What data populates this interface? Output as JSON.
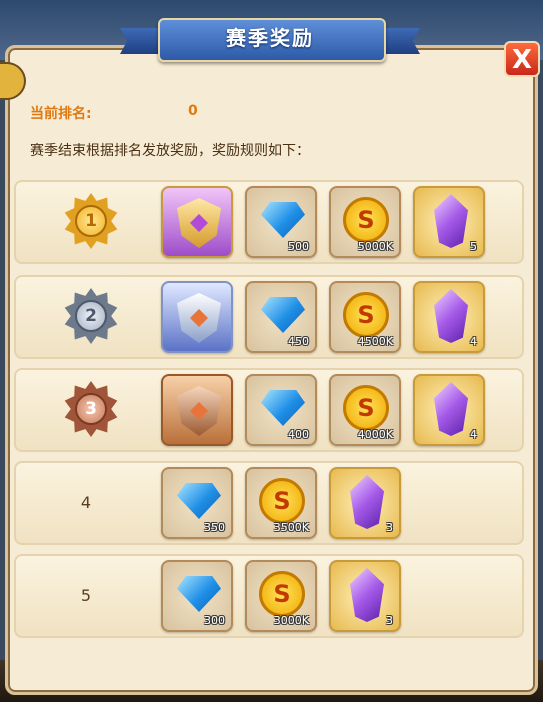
{
  "dialog": {
    "title": "赛季奖励",
    "close_label": "X"
  },
  "summary": {
    "rank_label": "当前排名:",
    "rank_value": "0",
    "rule_text": "赛季结束根据排名发放奖励，奖励规则如下："
  },
  "rewards": [
    {
      "rank": "1",
      "medal": "gold",
      "emblem": "gold",
      "items": [
        {
          "type": "gem",
          "qty": "500"
        },
        {
          "type": "coin",
          "qty": "5000K"
        },
        {
          "type": "crystal",
          "qty": "5"
        }
      ]
    },
    {
      "rank": "2",
      "medal": "silver",
      "emblem": "silver",
      "items": [
        {
          "type": "gem",
          "qty": "450"
        },
        {
          "type": "coin",
          "qty": "4500K"
        },
        {
          "type": "crystal",
          "qty": "4"
        }
      ]
    },
    {
      "rank": "3",
      "medal": "bronze",
      "emblem": "bronze",
      "items": [
        {
          "type": "gem",
          "qty": "400"
        },
        {
          "type": "coin",
          "qty": "4000K"
        },
        {
          "type": "crystal",
          "qty": "4"
        }
      ]
    },
    {
      "rank": "4",
      "medal": null,
      "emblem": null,
      "items": [
        {
          "type": "gem",
          "qty": "350"
        },
        {
          "type": "coin",
          "qty": "3500K"
        },
        {
          "type": "crystal",
          "qty": "3"
        }
      ]
    },
    {
      "rank": "5",
      "medal": null,
      "emblem": null,
      "items": [
        {
          "type": "gem",
          "qty": "300"
        },
        {
          "type": "coin",
          "qty": "3000K"
        },
        {
          "type": "crystal",
          "qty": "3"
        }
      ]
    }
  ],
  "icons": {
    "coin_glyph": "S"
  },
  "colors": {
    "accent": "#e07a10",
    "panel": "#f6ecd6",
    "close": "#d8321f",
    "title_ribbon": "#3f6fc0"
  }
}
